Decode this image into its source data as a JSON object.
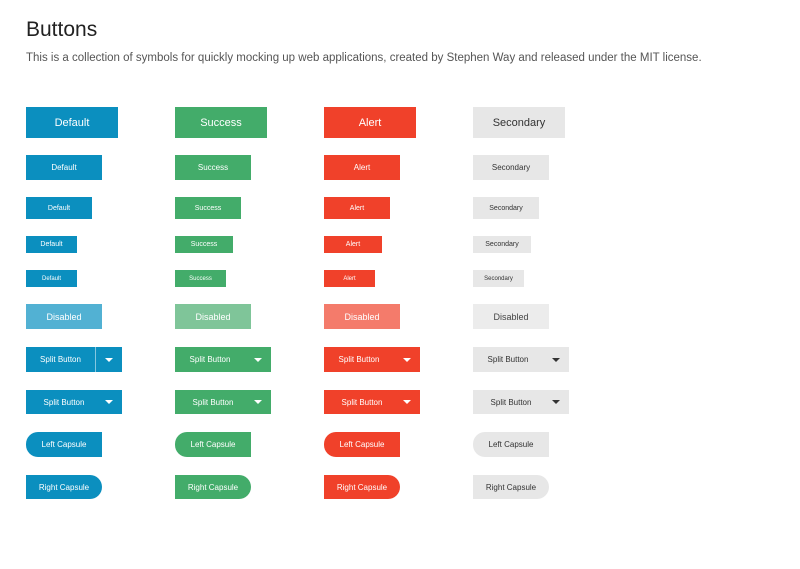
{
  "page": {
    "title": "Buttons",
    "subtitle": "This is a collection of symbols for quickly mocking up web applications, created by Stephen Way and released under the MIT license."
  },
  "columns": [
    {
      "variant": "default",
      "color": "#0b8fbf",
      "size_labels": [
        "Default",
        "Default",
        "Default",
        "Default",
        "Default"
      ],
      "disabled": "Disabled",
      "split_button": "Split Button",
      "split_button_2": "Split Button",
      "left_capsule": "Left Capsule",
      "right_capsule": "Right Capsule"
    },
    {
      "variant": "success",
      "color": "#43ac6a",
      "size_labels": [
        "Success",
        "Success",
        "Success",
        "Success",
        "Success"
      ],
      "disabled": "Disabled",
      "split_button": "Split Button",
      "split_button_2": "Split Button",
      "left_capsule": "Left Capsule",
      "right_capsule": "Right Capsule"
    },
    {
      "variant": "alert",
      "color": "#f0412a",
      "size_labels": [
        "Alert",
        "Alert",
        "Alert",
        "Alert",
        "Alert"
      ],
      "disabled": "Disabled",
      "split_button": "Split Button",
      "split_button_2": "Split Button",
      "left_capsule": "Left Capsule",
      "right_capsule": "Right Capsule"
    },
    {
      "variant": "secondary",
      "color": "#e7e7e7",
      "size_labels": [
        "Secondary",
        "Secondary",
        "Secondary",
        "Secondary",
        "Secondary"
      ],
      "disabled": "Disabled",
      "split_button": "Split Button",
      "split_button_2": "Split Button",
      "left_capsule": "Left Capsule",
      "right_capsule": "Right Capsule"
    }
  ],
  "icons": {
    "split_caret": "caret-down-icon"
  }
}
